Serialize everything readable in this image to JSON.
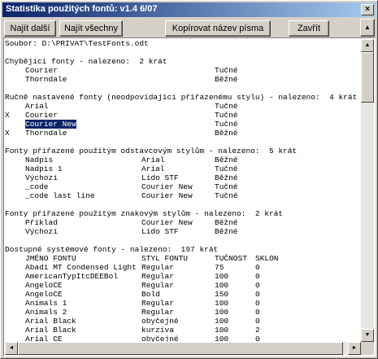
{
  "window": {
    "title": "Statistika použitých fontů:   v1.4  6/07",
    "close_glyph": "×"
  },
  "toolbar": {
    "find_next": "Najít další",
    "find_all": "Najít všechny",
    "copy_font_name": "Kopírovat název písma",
    "close": "Zavřít",
    "up_glyph": "▲"
  },
  "scroll": {
    "up": "▲",
    "down": "▼",
    "left": "◄",
    "right": "►"
  },
  "report": {
    "lines": [
      {
        "cols": [
          "Soubor: D:\\PRIVAT\\TestFonts.odt"
        ]
      },
      {
        "cols": [
          ""
        ]
      },
      {
        "cols": [
          "Chybějící fonty - nalezeno:  2 krát"
        ]
      },
      {
        "cols": [
          "",
          "Courier",
          "",
          "Tučné"
        ]
      },
      {
        "cols": [
          "",
          "Thorndale",
          "",
          "Běžné"
        ]
      },
      {
        "cols": [
          ""
        ]
      },
      {
        "cols": [
          "Ručně nastavené fonty (neodpovídající přiřazenému stylu) - nalezeno:  4 krát"
        ]
      },
      {
        "cols": [
          "",
          "Arial",
          "",
          "Tučné"
        ]
      },
      {
        "cols": [
          "X",
          "Courier",
          "",
          "Tučné"
        ]
      },
      {
        "cols": [
          "",
          "Courier New",
          "",
          "Tučné"
        ],
        "selected": true
      },
      {
        "cols": [
          "X",
          "Thorndale",
          "",
          "Běžné"
        ]
      },
      {
        "cols": [
          ""
        ]
      },
      {
        "cols": [
          "Fonty přiřazené použitým odstavcovým stylům - nalezeno:  5 krát"
        ]
      },
      {
        "cols": [
          "",
          "Nadpis",
          "Arial",
          "Běžné"
        ]
      },
      {
        "cols": [
          "",
          "Nadpis 1",
          "Arial",
          "Tučné"
        ]
      },
      {
        "cols": [
          "",
          "Výchozí",
          "Lido STF",
          "Běžné"
        ]
      },
      {
        "cols": [
          "",
          "_code",
          "Courier New",
          "Tučné"
        ]
      },
      {
        "cols": [
          "",
          "_code last line",
          "Courier New",
          "Tučné"
        ]
      },
      {
        "cols": [
          ""
        ]
      },
      {
        "cols": [
          "Fonty přiřazené použitým znakovým stylům - nalezeno:  2 krát"
        ]
      },
      {
        "cols": [
          "",
          "Příklad",
          "Courier New",
          "Běžné"
        ]
      },
      {
        "cols": [
          "",
          "Výchozí",
          "Lido STF",
          "Běžné"
        ]
      },
      {
        "cols": [
          ""
        ]
      },
      {
        "cols": [
          "Dostupné systémové fonty - nalezeno:  197 krát"
        ]
      },
      {
        "cols": [
          "",
          "JMÉNO FONTU",
          "STYL FONTU",
          "TUČNOST",
          "SKLON"
        ]
      },
      {
        "cols": [
          "",
          "Abadi MT Condensed Light",
          "Regular",
          "75",
          "0"
        ]
      },
      {
        "cols": [
          "",
          "AmericanTypItcDEEBol",
          "Regular",
          "100",
          "0"
        ]
      },
      {
        "cols": [
          "",
          "AngeloCE",
          "Regular",
          "100",
          "0"
        ]
      },
      {
        "cols": [
          "",
          "AngeloCE",
          "Bold",
          "150",
          "0"
        ]
      },
      {
        "cols": [
          "",
          "Animals 1",
          "Regular",
          "100",
          "0"
        ]
      },
      {
        "cols": [
          "",
          "Animals 2",
          "Regular",
          "100",
          "0"
        ]
      },
      {
        "cols": [
          "",
          "Arial Black",
          "obyčejné",
          "100",
          "0"
        ]
      },
      {
        "cols": [
          "",
          "Arial Black",
          "kurzíva",
          "100",
          "2"
        ]
      },
      {
        "cols": [
          "",
          "Arial CE",
          "obyčejné",
          "100",
          "0"
        ]
      }
    ]
  }
}
